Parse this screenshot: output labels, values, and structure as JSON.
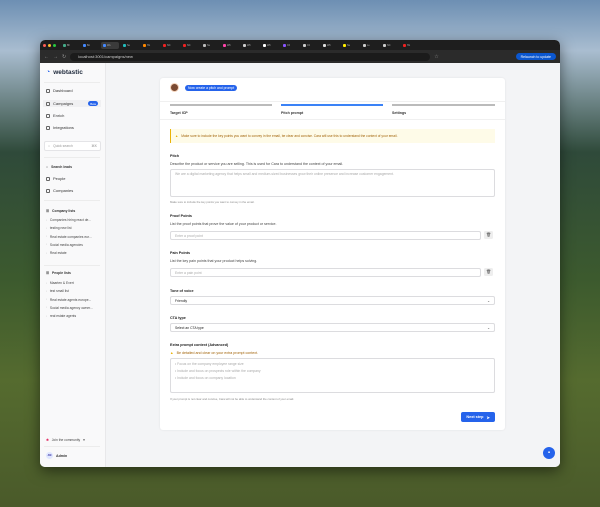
{
  "browser": {
    "url": "localhost:3001/campaigns/new",
    "relaunch": "Relaunch to update",
    "tabs": [
      "Bh",
      "Bo",
      "We",
      "Se",
      "Ho",
      "NC",
      "NC",
      "Ne",
      "Wh",
      "Wh",
      "Wh",
      "Ch",
      "Cli",
      "Wh",
      "Ne",
      "Le",
      "NC",
      "Ho"
    ]
  },
  "sidebar": {
    "brand": "webtastic",
    "nav": [
      {
        "label": "Dashboard"
      },
      {
        "label": "Campaigns",
        "badge": "Beta"
      },
      {
        "label": "Enrich"
      },
      {
        "label": "Integrations"
      }
    ],
    "search_placeholder": "Quick search",
    "search_shortcut": "⌘K",
    "search_leads": "Search leads",
    "people": "People",
    "companies": "Companies",
    "company_lists_title": "Company lists",
    "company_lists": [
      "Companies hiring react de...",
      "testing new list",
      "Real estate companies eur...",
      "Social media agencies",
      "Real estate"
    ],
    "people_lists_title": "People lists",
    "people_lists": [
      "Maarten & Evert",
      "test small list",
      "Real estate agents europe...",
      "Social media agency owner...",
      "real estate agents"
    ],
    "community": "Join the community",
    "user_initials": "AM",
    "user": "Admin"
  },
  "card": {
    "prompt_bubble": "Now create a pitch and prompt",
    "steps": [
      {
        "label": "Target ICP",
        "state": "done"
      },
      {
        "label": "Pitch prompt",
        "state": "active"
      },
      {
        "label": "Settings",
        "state": "todo"
      }
    ],
    "warning": "Make sure to include the key points you want to convey in the email, be clear and concise. Cara will use this to understand the context of your email.",
    "pitch": {
      "label": "Pitch",
      "desc": "Describe the product or service you are selling. This is used for Cara to understand the context of your email.",
      "placeholder": "We are a digital marketing agency that helps small and medium-sized businesses grow their online presence and increase customer engagement.",
      "hint": "Make sure to include the key points you want to convey in the email."
    },
    "proof": {
      "label": "Proof Points",
      "desc": "List the proof points that prove the value of your product or service.",
      "placeholder": "Enter a proof point"
    },
    "pain": {
      "label": "Pain Points",
      "desc": "List the key pain points that your product helps solving.",
      "placeholder": "Enter a pain point"
    },
    "tone": {
      "label": "Tone of voice",
      "value": "Friendly"
    },
    "cta": {
      "label": "CTA type",
      "value": "Select an CTA type"
    },
    "extra": {
      "label": "Extra prompt context (Advanced)",
      "warning": "Be detailed and clear on your extra prompt context.",
      "placeholder_lines": [
        "• Focus on the company employee range size",
        "• Include and focus on prospects role within the company",
        "• Include and focus on company location"
      ],
      "hint": "If your prompt is not clear and concise, Cara will not be able to understand the context of your email."
    },
    "next": "Next step"
  },
  "colors": {
    "accent": "#2563eb",
    "warning_bg": "#fefbe8",
    "warning_text": "#a16207"
  }
}
